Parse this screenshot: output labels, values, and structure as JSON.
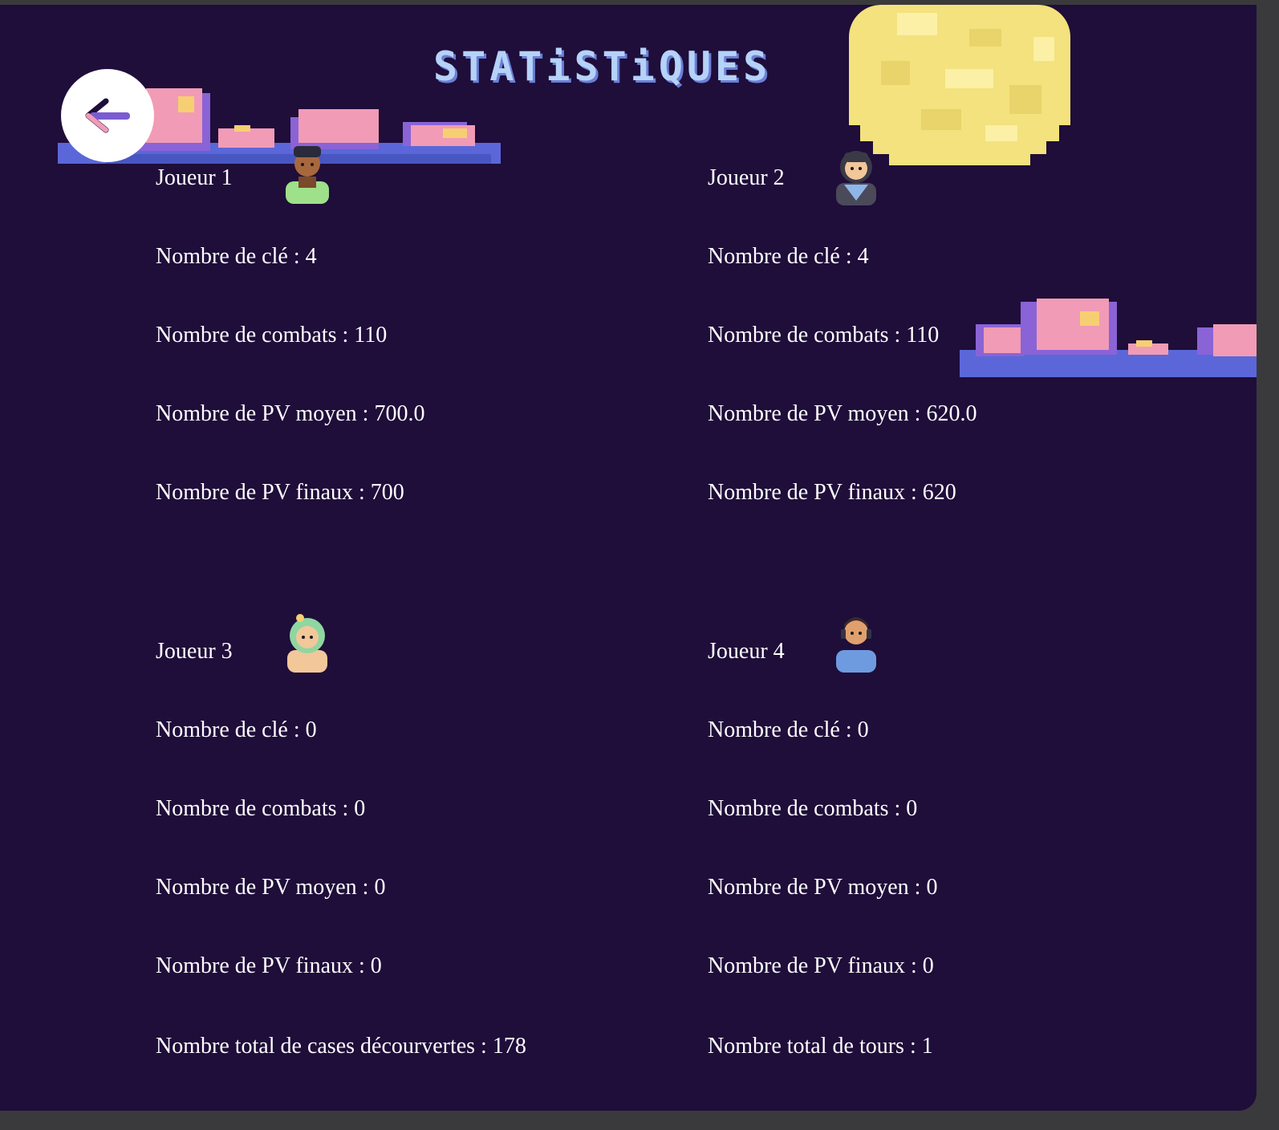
{
  "page": {
    "title": "STATiSTiQUES",
    "back_icon": "arrow-left-icon",
    "colors": {
      "background": "#1f0d3a",
      "text": "#ffffff",
      "title": "#b5d2f8",
      "moon": "#f3e27d",
      "cloud_pink": "#f19bb6",
      "cloud_blue": "#5b67d8"
    }
  },
  "players": [
    {
      "name": "Joueur 1",
      "avatar": "avatar-hoodie-boy-icon",
      "stats": [
        "Nombre de clé : 4",
        "Nombre de combats : 110",
        "Nombre de PV moyen : 700.0",
        "Nombre de PV finaux : 700"
      ]
    },
    {
      "name": "Joueur 2",
      "avatar": "avatar-sailor-girl-icon",
      "stats": [
        "Nombre de clé : 4",
        "Nombre de combats : 110",
        "Nombre de PV moyen : 620.0",
        "Nombre de PV finaux : 620"
      ]
    },
    {
      "name": "Joueur 3",
      "avatar": "avatar-green-hair-girl-icon",
      "stats": [
        "Nombre de clé : 0",
        "Nombre de combats : 0",
        "Nombre de PV moyen : 0",
        "Nombre de PV finaux : 0"
      ]
    },
    {
      "name": "Joueur 4",
      "avatar": "avatar-headset-boy-icon",
      "stats": [
        "Nombre de clé : 0",
        "Nombre de combats : 0",
        "Nombre de PV moyen : 0",
        "Nombre de PV finaux : 0"
      ]
    }
  ],
  "totals": {
    "cells": "Nombre total de cases décourvertes : 178",
    "turns": "Nombre total de tours : 1"
  }
}
